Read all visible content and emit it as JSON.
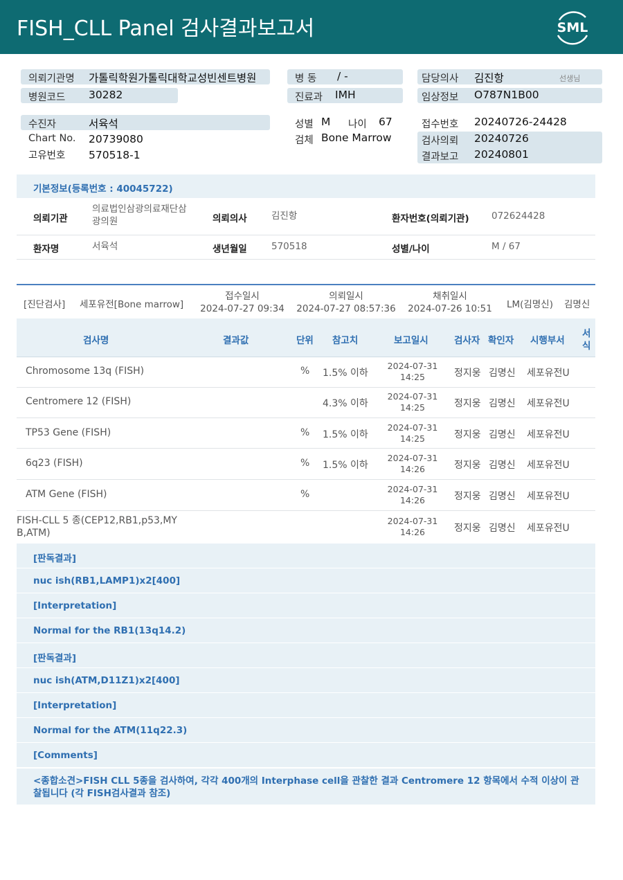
{
  "header": {
    "title": "FISH_CLL  Panel 검사결과보고서",
    "logo_text": "SML"
  },
  "patient": {
    "requesting_institution_label": "의뢰기관명",
    "requesting_institution": "가톨릭학원가톨릭대학교성빈센트병원",
    "hospital_code_label": "병원코드",
    "hospital_code": "30282",
    "ward_label": "병  동",
    "ward": "/ -",
    "department_label": "진료과",
    "department": "IMH",
    "doctor_label": "담당의사",
    "doctor": "김진항",
    "doctor_suffix": "선생님",
    "clinical_info_label": "임상정보",
    "clinical_info": "O787N1B00",
    "patient_label": "수진자",
    "patient_name": "서육석",
    "chart_no_label": "Chart No.",
    "chart_no": "20739080",
    "unique_no_label": "고유번호",
    "unique_no": "570518-1",
    "sex_label": "성별",
    "sex": "M",
    "age_label": "나이",
    "age": "67",
    "specimen_label": "검체",
    "specimen": "Bone Marrow",
    "reception_no_label": "접수번호",
    "reception_no": "20240726-24428",
    "exam_request_label": "검사의뢰",
    "exam_request": "20240726",
    "result_report_label": "결과보고",
    "result_report": "20240801"
  },
  "basic_info": {
    "heading": "기본정보(등록번호 : 40045722)",
    "inst_label": "의뢰기관",
    "inst_line1": "의료법인삼광의료재단삼",
    "inst_line2": "광의원",
    "doc_label": "의뢰의사",
    "doc": "김진항",
    "pno_label": "환자번호(의뢰기관)",
    "pno": "072624428",
    "name_label": "환자명",
    "name": "서육석",
    "dob_label": "생년월일",
    "dob": "570518",
    "sexage_label": "성별/나이",
    "sexage": "M / 67"
  },
  "exam": {
    "category": "[진단검사]",
    "type": "세포유전[Bone marrow]",
    "received_label": "접수일시",
    "received": "2024-07-27 09:34",
    "requested_label": "의뢰일시",
    "requested": "2024-07-27 08:57:36",
    "collected_label": "채취일시",
    "collected": "2024-07-26 10:51",
    "lm": "LM(김명신)",
    "lm_name": "김명신"
  },
  "table_headers": {
    "test": "검사명",
    "result": "결과값",
    "unit": "단위",
    "ref": "참고치",
    "report_time": "보고일시",
    "tester": "검사자",
    "verifier": "확인자",
    "dept": "시행부서",
    "code_l1": "서",
    "code_l2": "식"
  },
  "rows": [
    {
      "name": "Chromosome 13q (FISH)",
      "unit": "%",
      "ref": "1.5% 이하",
      "date": "2024-07-31",
      "time": "14:25",
      "tester": "정지웅",
      "verifier": "김명신",
      "dept": "세포유전U"
    },
    {
      "name": "Centromere 12 (FISH)",
      "unit": "",
      "ref": "4.3% 이하",
      "date": "2024-07-31",
      "time": "14:25",
      "tester": "정지웅",
      "verifier": "김명신",
      "dept": "세포유전U"
    },
    {
      "name": "TP53 Gene (FISH)",
      "unit": "%",
      "ref": "1.5% 이하",
      "date": "2024-07-31",
      "time": "14:25",
      "tester": "정지웅",
      "verifier": "김명신",
      "dept": "세포유전U"
    },
    {
      "name": "6q23 (FISH)",
      "unit": "%",
      "ref": "1.5% 이하",
      "date": "2024-07-31",
      "time": "14:26",
      "tester": "정지웅",
      "verifier": "김명신",
      "dept": "세포유전U"
    },
    {
      "name": "ATM Gene (FISH)",
      "unit": "%",
      "ref": "",
      "date": "2024-07-31",
      "time": "14:26",
      "tester": "정지웅",
      "verifier": "김명신",
      "dept": "세포유전U"
    },
    {
      "name_l1": "FISH-CLL 5 종(CEP12,RB1,p53,MY",
      "name_l2": "B,ATM)",
      "date": "2024-07-31",
      "time": "14:26",
      "tester": "정지웅",
      "verifier": "김명신",
      "dept": "세포유전U"
    }
  ],
  "notes": [
    "[판독결과]",
    "nuc ish(RB1,LAMP1)x2[400]",
    "[Interpretation]",
    "Normal for the RB1(13q14.2)",
    "[판독결과]",
    "nuc ish(ATM,D11Z1)x2[400]",
    "[Interpretation]",
    "Normal for the ATM(11q22.3)",
    "[Comments]"
  ],
  "summary": "<종합소견>FISH CLL 5종을 검사하여, 각각 400개의 Interphase cell을 관찰한 결과 Centromere 12 항목에서 수적 이상이 관찰됩니다 (각 FISH검사결과 참조)",
  "colors": {
    "header_bg": "#0e6b72",
    "accent_blue": "#2f6fb1",
    "pill_bg": "#d9e5ec",
    "section_bg": "#e8f1f6"
  }
}
